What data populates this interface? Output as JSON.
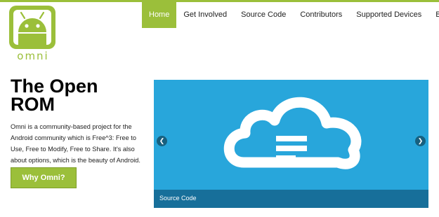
{
  "logo": {
    "text": "omni",
    "icon": "android-robot-icon"
  },
  "nav": {
    "items": [
      {
        "label": "Home",
        "active": true
      },
      {
        "label": "Get Involved",
        "active": false
      },
      {
        "label": "Source Code",
        "active": false
      },
      {
        "label": "Contributors",
        "active": false
      },
      {
        "label": "Supported Devices",
        "active": false
      },
      {
        "label": "Blog",
        "active": false
      }
    ]
  },
  "hero": {
    "title": "The Open ROM",
    "description": "Omni is a community-based project for the Android community which is Free^3: Free to Use, Free to Modify, Free to Share. It's also about options, which is the beauty of Android.",
    "button_label": "Why Omni?"
  },
  "carousel": {
    "slide_icon": "cloud-icon",
    "caption": "Source Code",
    "prev_icon": "chevron-left-icon",
    "next_icon": "chevron-right-icon"
  },
  "colors": {
    "brand_green": "#9bbf3a",
    "slide_blue": "#28a6db",
    "caption_blue": "#176f9a"
  }
}
